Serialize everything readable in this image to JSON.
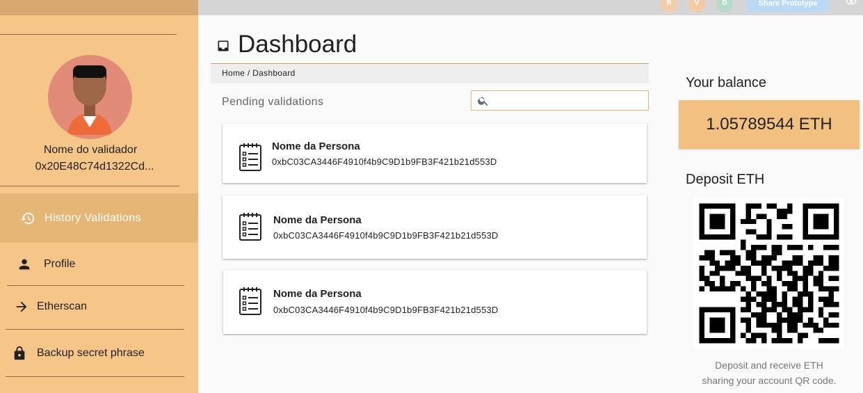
{
  "topbar": {
    "collaborators": [
      "R",
      "V",
      "D"
    ],
    "share_label": "Share Prototype",
    "eye_icon": "eye-icon"
  },
  "sidebar": {
    "validator_name": "Nome do validador",
    "validator_address": "0x20E48C74d1322Cd...",
    "items": [
      {
        "label": "History Validations",
        "icon": "history-icon",
        "active": true
      },
      {
        "label": "Profile",
        "icon": "person-icon",
        "active": false
      },
      {
        "label": "Etherscan",
        "icon": "arrow-right-icon",
        "active": false
      },
      {
        "label": "Backup secret phrase",
        "icon": "lock-icon",
        "active": false
      }
    ]
  },
  "main": {
    "title": "Dashboard",
    "title_icon": "inbox-icon",
    "breadcrumb": "Home / Dashboard",
    "pending_label": "Pending validations",
    "search": {
      "value": "",
      "placeholder": ""
    },
    "validations": [
      {
        "name": "Nome da Persona",
        "address": "0xbC03CA3446F4910f4b9C9D1b9FB3F421b21d553D"
      },
      {
        "name": "Nome da Persona",
        "address": "0xbC03CA3446F4910f4b9C9D1b9FB3F421b21d553D"
      },
      {
        "name": "Nome da Persona",
        "address": "0xbC03CA3446F4910f4b9C9D1b9FB3F421b21d553D"
      }
    ]
  },
  "wallet": {
    "balance_label": "Your balance",
    "balance": "1.05789544 ETH",
    "deposit_label": "Deposit ETH",
    "deposit_line1": "Deposit and receive ETH",
    "deposit_line2": "sharing your account QR code."
  },
  "colors": {
    "sidebar": "#f5c688",
    "accent": "#f2c07f",
    "active_item": "#e5b676"
  }
}
